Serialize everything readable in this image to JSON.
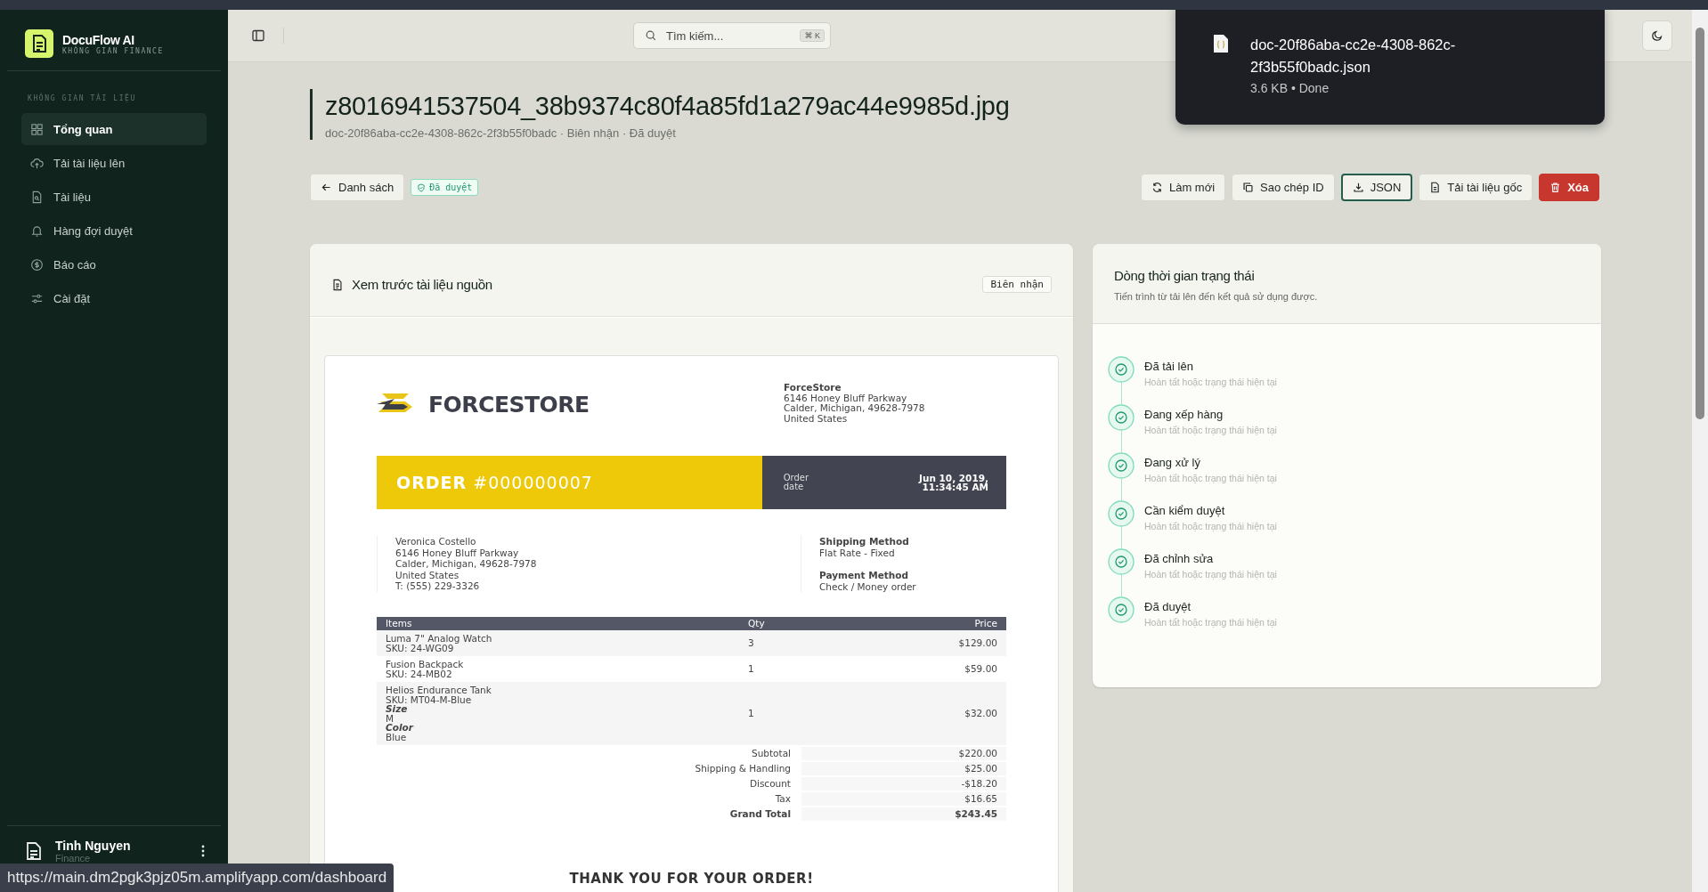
{
  "sidebar": {
    "brand": "DocuFlow AI",
    "workspace": "KHÔNG GIAN FINANCE",
    "section_label": "KHÔNG GIAN TÀI LIỆU",
    "items": [
      {
        "label": "Tổng quan",
        "selected": true
      },
      {
        "label": "Tải tài liệu lên",
        "selected": false
      },
      {
        "label": "Tài liệu",
        "selected": false
      },
      {
        "label": "Hàng đợi duyệt",
        "selected": false
      },
      {
        "label": "Báo cáo",
        "selected": false
      },
      {
        "label": "Cài đặt",
        "selected": false
      }
    ],
    "user": {
      "name": "Tinh Nguyen",
      "role": "Finance"
    }
  },
  "topbar": {
    "search": {
      "placeholder": "Tìm kiếm...",
      "shortcut": "⌘ K"
    }
  },
  "document": {
    "title": "z8016941537504_38b9374c80f4a85fd1a279ac44e9985d.jpg",
    "meta": "doc-20f86aba-cc2e-4308-862c-2f3b55f0badc · Biên nhận · Đã duyệt",
    "status_badge": "Đã duyệt"
  },
  "actions": {
    "back": "Danh sách",
    "buttons": [
      {
        "label": "Làm mới",
        "kind": "default"
      },
      {
        "label": "Sao chép ID",
        "kind": "default"
      },
      {
        "label": "JSON",
        "kind": "focused"
      },
      {
        "label": "Tải tài liệu gốc",
        "kind": "default"
      },
      {
        "label": "Xóa",
        "kind": "danger"
      }
    ]
  },
  "preview": {
    "title": "Xem trước tài liệu nguồn",
    "tag": "Biên nhận",
    "receipt": {
      "brand": "FORCESTORE",
      "store": {
        "name": "ForceStore",
        "address": [
          "6146 Honey Bluff Parkway",
          "Calder, Michigan, 49628-7978",
          "United States"
        ]
      },
      "order": "**ORDER** #000000007",
      "order_date_label": "Order date",
      "order_date": [
        "Jun 10, 2019,",
        "11:34:45 AM"
      ],
      "customer": [
        "Veronica Costello",
        "6146 Honey Bluff Parkway",
        "Calder, Michigan, 49628-7978",
        "United States",
        "T: (555) 229-3326"
      ],
      "shipping": {
        "label": "Shipping Method",
        "value": "Flat Rate - Fixed"
      },
      "payment": {
        "label": "Payment Method",
        "value": "Check / Money order"
      },
      "columns": [
        "Items",
        "Qty",
        "Price"
      ],
      "items": [
        {
          "name": "Luma 7\" Analog Watch",
          "sku": "SKU: 24-WG09",
          "qty": "3",
          "price": "$129.00"
        },
        {
          "name": "Fusion Backpack",
          "sku": "SKU: 24-MB02",
          "qty": "1",
          "price": "$59.00"
        },
        {
          "name": "Helios Endurance Tank",
          "sku": "SKU: MT04-M-Blue",
          "options": [
            {
              "name": "Size",
              "value": "M"
            },
            {
              "name": "Color",
              "value": "Blue"
            }
          ],
          "qty": "1",
          "price": "$32.00"
        }
      ],
      "totals": [
        {
          "label": "Subtotal",
          "value": "$220.00",
          "emphasis": false
        },
        {
          "label": "Shipping & Handling",
          "value": "$25.00",
          "emphasis": false
        },
        {
          "label": "Discount",
          "value": "-$18.20",
          "emphasis": false
        },
        {
          "label": "Tax",
          "value": "$16.65",
          "emphasis": false
        },
        {
          "label": "Grand Total",
          "value": "$243.45",
          "emphasis": true
        }
      ],
      "thanks": "THANK YOU FOR YOUR ORDER!"
    }
  },
  "timeline": {
    "title": "Dòng thời gian trạng thái",
    "subtitle": "Tiến trình từ tải lên đến kết quả sử dụng được.",
    "steps": [
      {
        "label": "Đã tải lên",
        "note": "Hoàn tất hoặc trạng thái hiện tại",
        "done": true
      },
      {
        "label": "Đang xếp hàng",
        "note": "Hoàn tất hoặc trạng thái hiện tại",
        "done": true
      },
      {
        "label": "Đang xử lý",
        "note": "Hoàn tất hoặc trạng thái hiện tại",
        "done": true
      },
      {
        "label": "Cần kiểm duyệt",
        "note": "Hoàn tất hoặc trạng thái hiện tại",
        "done": true
      },
      {
        "label": "Đã chỉnh sửa",
        "note": "Hoàn tất hoặc trạng thái hiện tại",
        "done": true
      },
      {
        "label": "Đã duyệt",
        "note": "Hoàn tất hoặc trạng thái hiện tại",
        "done": true
      }
    ]
  },
  "download_popup": {
    "filename": "doc-20f86aba-cc2e-4308-862c-2f3b55f0badc.json",
    "info": "3.6 KB • Done"
  },
  "status_url": "https://main.dm2pgk3pjz05m.amplifyapp.com/dashboard"
}
